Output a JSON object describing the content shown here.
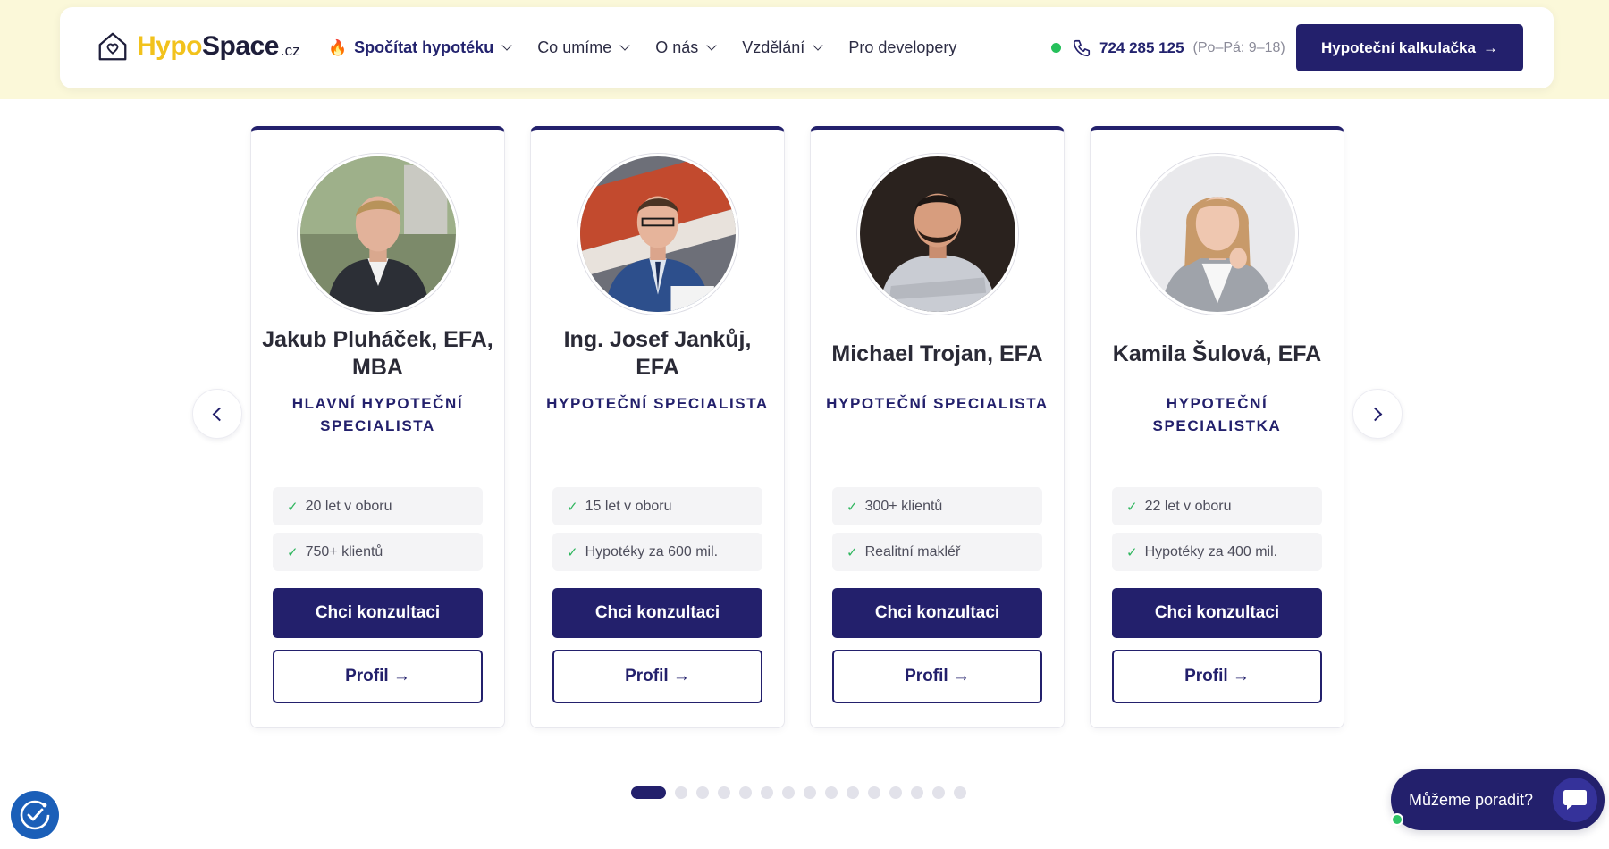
{
  "brand": {
    "logo_part1": "Hypo",
    "logo_part2": "Space",
    "logo_tld": ".cz",
    "accent_color": "#f2c21c",
    "primary_color": "#23206c"
  },
  "nav": {
    "items": [
      {
        "label": "Spočítat hypotéku",
        "has_dropdown": true,
        "highlight": true,
        "icon": "fire-icon"
      },
      {
        "label": "Co umíme",
        "has_dropdown": true
      },
      {
        "label": "O nás",
        "has_dropdown": true
      },
      {
        "label": "Vzdělání",
        "has_dropdown": true
      },
      {
        "label": "Pro developery",
        "has_dropdown": false
      }
    ],
    "phone": "724 285 125",
    "hours": "(Po–Pá: 9–18)",
    "cta_label": "Hypoteční kalkulačka",
    "cta_arrow": "→"
  },
  "carousel": {
    "prev_icon": "chevron-left-icon",
    "next_icon": "chevron-right-icon",
    "cards": [
      {
        "name": "Jakub Pluháček, EFA, MBA",
        "role": "HLAVNÍ HYPOTEČNÍ SPECIALISTA",
        "stats": [
          "20 let v oboru",
          "750+ klientů"
        ],
        "consult_label": "Chci konzultaci",
        "profile_label": "Profil →"
      },
      {
        "name": "Ing. Josef Jankůj, EFA",
        "role": "HYPOTEČNÍ SPECIALISTA",
        "stats": [
          "15 let v oboru",
          "Hypotéky za 600 mil."
        ],
        "consult_label": "Chci konzultaci",
        "profile_label": "Profil →"
      },
      {
        "name": "Michael Trojan, EFA",
        "role": "HYPOTEČNÍ SPECIALISTA",
        "stats": [
          "300+ klientů",
          "Realitní makléř"
        ],
        "consult_label": "Chci konzultaci",
        "profile_label": "Profil →"
      },
      {
        "name": "Kamila Šulová, EFA",
        "role": "HYPOTEČNÍ SPECIALISTKA",
        "stats": [
          "22 let v oboru",
          "Hypotéky za 400 mil."
        ],
        "consult_label": "Chci konzultaci",
        "profile_label": "Profil →"
      }
    ],
    "page_count": 15,
    "active_page": 1
  },
  "chat": {
    "label": "Můžeme poradit?"
  }
}
